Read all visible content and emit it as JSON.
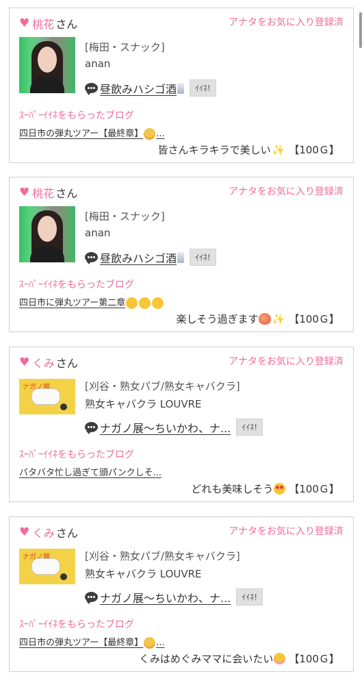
{
  "cards": [
    {
      "user": "桃花",
      "honorific": "さん",
      "fav_status": "アナタをお気に入り登録済",
      "shop": "[梅田・スナック]",
      "shop_name": "anan",
      "blog_title": "昼飲みハシゴ酒",
      "iine": "ｲｲﾈ!",
      "super_label": "ｽｰﾊﾟｰｲｲﾈをもらったブログ",
      "blog_link": "四日市の弾丸ツアー【最終章】",
      "blog_link_suffix": "...",
      "comment": "皆さんキラキラで美しい",
      "points": "【100Ｇ】",
      "thumb": "photo"
    },
    {
      "user": "桃花",
      "honorific": "さん",
      "fav_status": "アナタをお気に入り登録済",
      "shop": "[梅田・スナック]",
      "shop_name": "anan",
      "blog_title": "昼飲みハシゴ酒",
      "iine": "ｲｲﾈ!",
      "super_label": "ｽｰﾊﾟｰｲｲﾈをもらったブログ",
      "blog_link": "四日市に弾丸ツアー第二章",
      "comment": "楽しそう過ぎます",
      "points": "【100Ｇ】",
      "thumb": "photo"
    },
    {
      "user": "くみ",
      "honorific": "さん",
      "fav_status": "アナタをお気に入り登録済",
      "shop": "[刈谷・熟女パブ/熟女キャバクラ]",
      "shop_name": "熟女キャバクラ LOUVRE",
      "blog_title": "ナガノ展〜ちいかわ、ナ...",
      "iine": "ｲｲﾈ!",
      "super_label": "ｽｰﾊﾟｰｲｲﾈをもらったブログ",
      "blog_link": "バタバタ忙し過ぎて頭パンクしそ...",
      "comment": "どれも美味しそう",
      "points": "【100Ｇ】",
      "thumb": "flyer",
      "flyer_title": "ナガノ展"
    },
    {
      "user": "くみ",
      "honorific": "さん",
      "fav_status": "アナタをお気に入り登録済",
      "shop": "[刈谷・熟女パブ/熟女キャバクラ]",
      "shop_name": "熟女キャバクラ LOUVRE",
      "blog_title": "ナガノ展〜ちいかわ、ナ...",
      "iine": "ｲｲﾈ!",
      "super_label": "ｽｰﾊﾟｰｲｲﾈをもらったブログ",
      "blog_link": "四日市の弾丸ツアー【最終章】",
      "blog_link_suffix": "...",
      "comment": "くみはめぐみママに会いたい",
      "points": "【100Ｇ】",
      "thumb": "flyer",
      "flyer_title": "ナガノ展"
    }
  ]
}
